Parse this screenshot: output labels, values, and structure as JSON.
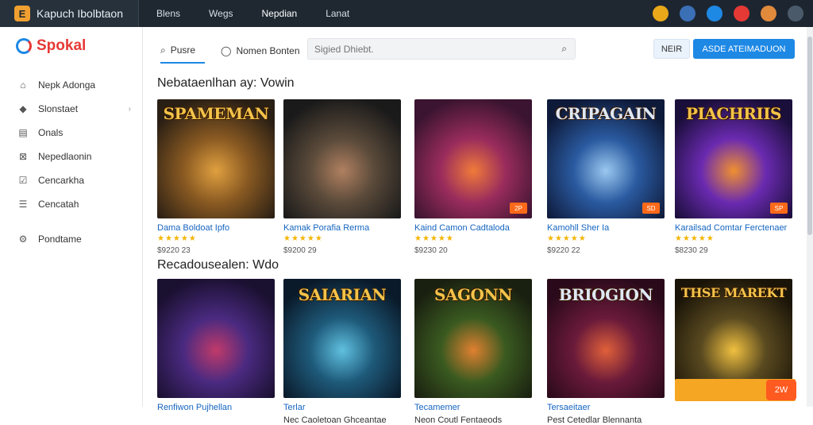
{
  "app": {
    "title": "Kapuch Ibolbtaon",
    "logo_letter": "E"
  },
  "topnav": [
    "Blens",
    "Wegs",
    "Nepdian",
    "Lanat"
  ],
  "top_icons": [
    {
      "name": "user-badge-icon",
      "color": "#e8a81a"
    },
    {
      "name": "globe-icon",
      "color": "#3b6fb6"
    },
    {
      "name": "app-icon",
      "color": "#1e88e5"
    },
    {
      "name": "notification-icon",
      "color": "#e53935"
    },
    {
      "name": "profile-icon",
      "color": "#e08a3c"
    },
    {
      "name": "avatar-icon",
      "color": "#4a5a6a"
    }
  ],
  "brand": {
    "name": "Spokal"
  },
  "sidebar": {
    "items": [
      {
        "label": "Nepk Adonga",
        "icon": "home-icon"
      },
      {
        "label": "Slonstaet",
        "icon": "tag-icon"
      },
      {
        "label": "Onals",
        "icon": "document-icon"
      },
      {
        "label": "Nepedlaonin",
        "icon": "grid-icon"
      },
      {
        "label": "Cencarkha",
        "icon": "check-icon"
      },
      {
        "label": "Cencatah",
        "icon": "list-icon"
      }
    ],
    "bottom_item": {
      "label": "Pondtame",
      "icon": "settings-icon"
    }
  },
  "header": {
    "tabs": [
      {
        "label": "Pusre",
        "icon": "search-icon"
      },
      {
        "label": "Nomen Bonten",
        "icon": "chat-icon"
      }
    ],
    "search_placeholder": "Sigied Dhiebt.",
    "secondary_button": "NEIR",
    "primary_button": "ASDE ATEIMADUON"
  },
  "sections": [
    {
      "title": "Nebataenlhan ay: Vowin",
      "cards": [
        {
          "art_title": "SPAMEMAN",
          "name": "Dama Boldoat Ipfo",
          "stars": "★★★★★",
          "meta": "$9220 23",
          "badge": "",
          "colors": [
            "#2a1f14",
            "#8a5a22",
            "#e0a040"
          ]
        },
        {
          "art_title": "",
          "name": "Kamak Porafia Rerma",
          "stars": "★★★★★",
          "meta": "$9200 29",
          "badge": "",
          "colors": [
            "#1a1a1a",
            "#5a4a3a",
            "#b08060"
          ]
        },
        {
          "art_title": "",
          "name": "Kaind Camon Cadtaloda",
          "stars": "★★★★★",
          "meta": "$9230 20",
          "badge": "2P",
          "colors": [
            "#3a1430",
            "#9a2c5c",
            "#f07a3a"
          ]
        },
        {
          "art_title": "CRIPAGAIN",
          "name": "Kamohll Sher Ia",
          "stars": "★★★★★",
          "meta": "$9220 22",
          "badge": "SD",
          "colors": [
            "#0e1a3a",
            "#2a5aa0",
            "#9ac8f0"
          ]
        },
        {
          "art_title": "PIACHRIIS",
          "name": "Karailsad Comtar Ferctenaer",
          "stars": "★★★★★",
          "meta": "$8230 29",
          "badge": "SP",
          "colors": [
            "#1a0e3a",
            "#6a2ab0",
            "#f09030"
          ]
        }
      ]
    },
    {
      "title": "Recadousealen: Wdo",
      "cards": [
        {
          "art_title": "",
          "name": "Renfiwon Pujhellan",
          "meta": "",
          "colors": [
            "#1a1030",
            "#4a2a80",
            "#c03a6a"
          ]
        },
        {
          "art_title": "SAIARIAN",
          "name": "Terlar",
          "meta": "Nec Caoletoan Ghceantae",
          "colors": [
            "#0a1a2a",
            "#1e5a7a",
            "#60c0e0"
          ]
        },
        {
          "art_title": "SAGONN",
          "name": "Tecamemer",
          "meta": "Neon Coutl Fentaeods",
          "colors": [
            "#1a2010",
            "#3a5a20",
            "#e08030"
          ]
        },
        {
          "art_title": "BRIOGION",
          "name": "Tersaeitaer",
          "meta": "Pest Cetedlar Blennanta",
          "colors": [
            "#2a0a1a",
            "#6a1a3a",
            "#e0603a"
          ]
        },
        {
          "art_title": "THSE MAREKT",
          "name": "",
          "meta": "",
          "colors": [
            "#1a1408",
            "#5a4a20",
            "#f0c040"
          ]
        }
      ]
    }
  ],
  "promo": {
    "button": "2W"
  }
}
